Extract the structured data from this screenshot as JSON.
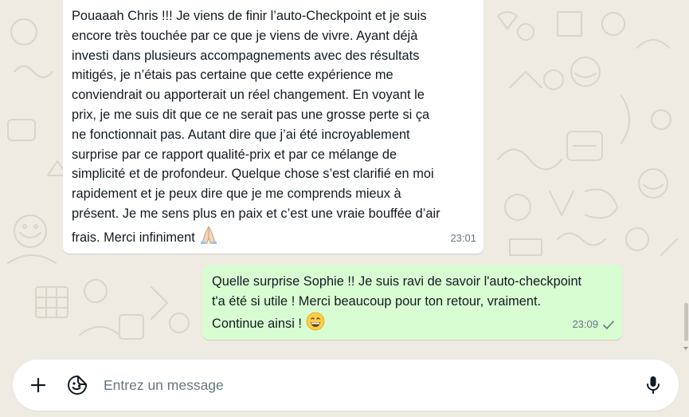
{
  "conversation": {
    "messages": [
      {
        "direction": "incoming",
        "text": "Pouaaah Chris !!! Je viens de finir l’auto-Checkpoint et je suis\nencore très touchée par ce que je viens de vivre. Ayant déjà\ninvesti dans plusieurs accompagnements avec des résultats\nmitigés, je n’étais pas certaine que cette expérience me\nconviendrait ou apporterait un réel changement. En voyant le\nprix, je me suis dit que ce ne serait pas une grosse perte si ça\nne fonctionnait pas. Autant dire que j’ai été incroyablement\nsurprise par ce rapport qualité-prix et par ce mélange de\nsimplicité et de profondeur. Quelque chose s’est clarifié en moi\nrapidement et je peux dire que je me comprends mieux à\nprésent. Je me sens plus en paix et c’est une vraie bouffée d’air\nfrais. Merci infiniment ",
        "emoji": "folded-hands-emoji",
        "time": "23:01"
      },
      {
        "direction": "outgoing",
        "text": "Quelle surprise Sophie !! Je suis ravi de savoir l'auto-checkpoint\nt'a été si utile ! Merci beaucoup pour ton retour, vraiment.\nContinue ainsi ! ",
        "emoji": "grinning-face-emoji",
        "time": "23:09",
        "status": "single-check-icon"
      }
    ]
  },
  "composer": {
    "placeholder": "Entrez un message",
    "value": "",
    "plus_icon": "plus-icon",
    "sticker_icon": "sticker-icon",
    "mic_icon": "microphone-icon"
  },
  "colors": {
    "background": "#efeae2",
    "incoming_bubble": "#ffffff",
    "outgoing_bubble": "#d9fdd3",
    "meta_text": "#667781",
    "icon": "#111b21"
  }
}
